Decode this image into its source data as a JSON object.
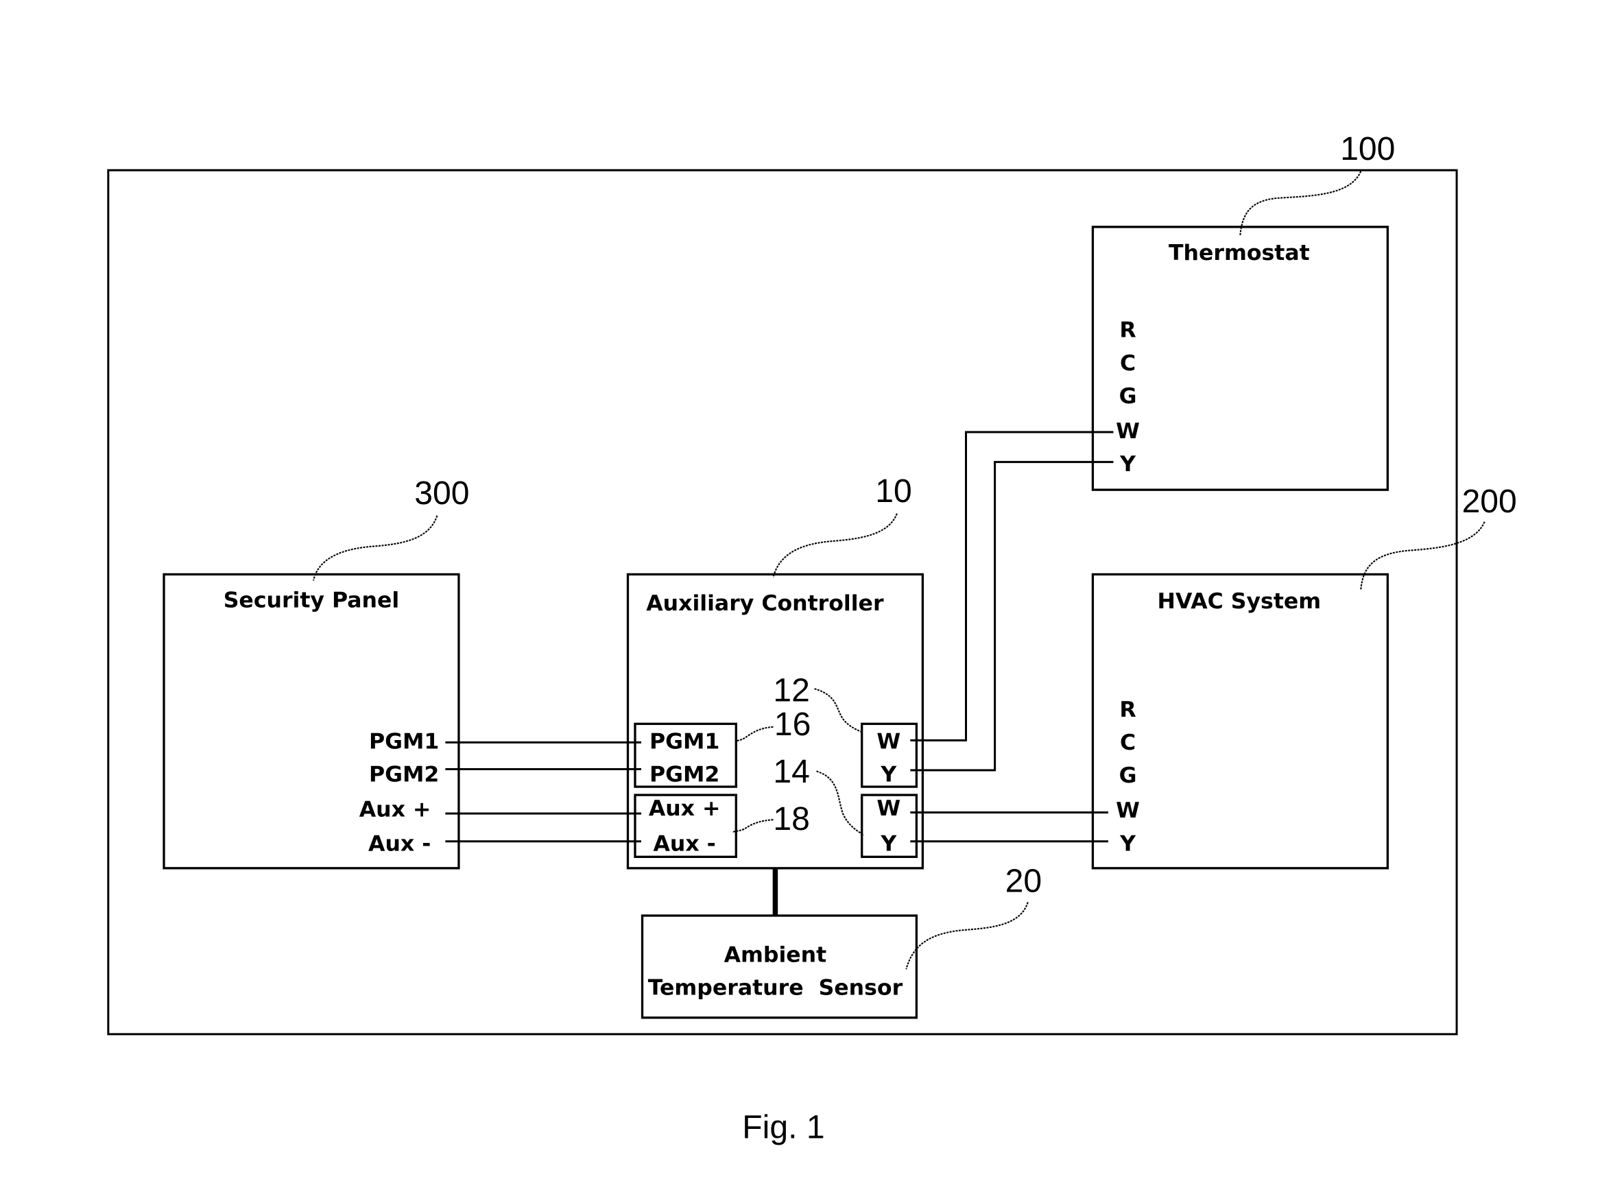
{
  "figure": {
    "caption": "Fig. 1",
    "reference_labels": {
      "thermostat": "100",
      "hvac": "200",
      "security_panel": "300",
      "aux_controller": "10",
      "terminal_block_thermostat": "12",
      "terminal_block_hvac": "14",
      "pgm_block": "16",
      "aux_block": "18",
      "sensor": "20"
    },
    "thermostat": {
      "title": "Thermostat",
      "terminals": [
        "R",
        "C",
        "G",
        "W",
        "Y"
      ]
    },
    "hvac": {
      "title": "HVAC System",
      "terminals": [
        "R",
        "C",
        "G",
        "W",
        "Y"
      ]
    },
    "security_panel": {
      "title": "Security Panel",
      "terminals": [
        "PGM1",
        "PGM2",
        "Aux +",
        "Aux -"
      ]
    },
    "aux_controller": {
      "title": "Auxiliary Controller",
      "pgm_terminals": [
        "PGM1",
        "PGM2"
      ],
      "aux_terminals": [
        "Aux +",
        "Aux -"
      ],
      "thermostat_side_terminals": [
        "W",
        "Y"
      ],
      "hvac_side_terminals": [
        "W",
        "Y"
      ]
    },
    "sensor": {
      "title_line1": "Ambient",
      "title_line2": "Temperature  Sensor"
    }
  }
}
